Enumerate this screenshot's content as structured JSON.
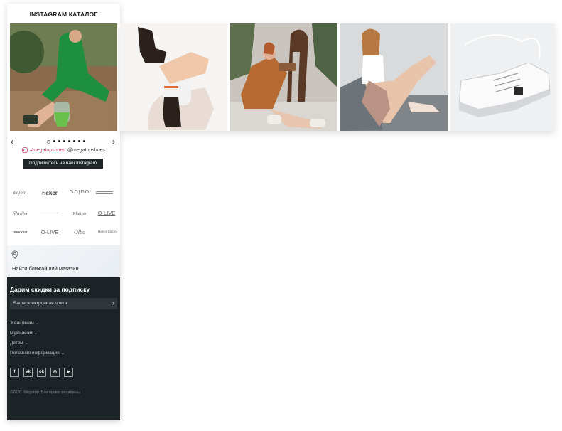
{
  "instagram_panel": {
    "title": "INSTAGRAM КАТАЛОГ",
    "prev_arrow": "‹",
    "next_arrow": "›",
    "handle_link": "#megatopshoes",
    "handle_plain": "@megatopshoes",
    "subscribe_button": "Подпишитесь на наш Instagram",
    "carousel_dots": 8,
    "carousel_active_index": 0
  },
  "brands": [
    {
      "name": "Enjoin",
      "row": 0,
      "col": 0
    },
    {
      "name": "rieker",
      "row": 0,
      "col": 1
    },
    {
      "name": "GO|DO",
      "row": 0,
      "col": 2
    },
    {
      "name": "",
      "row": 0,
      "col": 3
    },
    {
      "name": "Shuito",
      "row": 1,
      "col": 0
    },
    {
      "name": "",
      "row": 1,
      "col": 1
    },
    {
      "name": "Platino",
      "row": 1,
      "col": 2
    },
    {
      "name": "O-LIVE",
      "row": 1,
      "col": 3
    },
    {
      "name": "BEKKER",
      "row": 2,
      "col": 0
    },
    {
      "name": "O-LIVE",
      "row": 2,
      "col": 1
    },
    {
      "name": "Olbo",
      "row": 2,
      "col": 2
    },
    {
      "name": "Happy family",
      "row": 2,
      "col": 3
    }
  ],
  "store_finder": {
    "label": "Найти ближайший магазин"
  },
  "footer": {
    "subscribe_title": "Дарим скидки за подписку",
    "email_placeholder": "Ваша электронная почта",
    "menu": [
      "Женщинам",
      "Мужчинам",
      "Детям",
      "Полезная информация"
    ],
    "social_icons": [
      "facebook-icon",
      "vk-icon",
      "odnoklassniki-icon",
      "instagram-icon",
      "youtube-icon"
    ],
    "copyright": "©2020. Megatop. Все права защищены"
  },
  "colors": {
    "footer_bg": "#1c2327",
    "accent_pink": "#d6336c",
    "button_dark": "#1f2628"
  }
}
